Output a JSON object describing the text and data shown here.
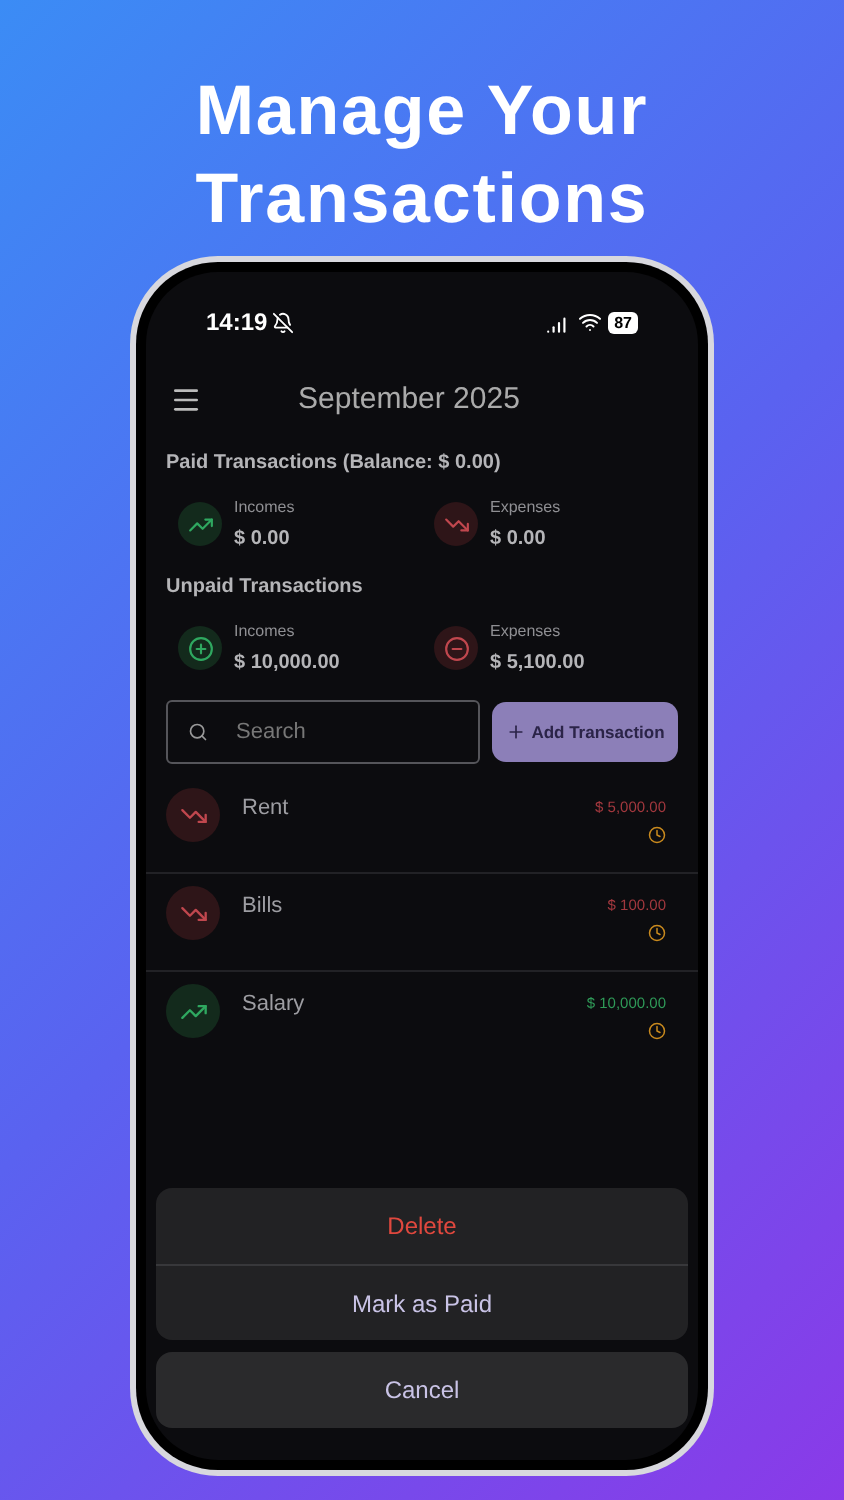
{
  "headline": [
    "Manage Your",
    "Transactions"
  ],
  "status_bar": {
    "time": "14:19",
    "battery": "87"
  },
  "header": {
    "title": "September 2025"
  },
  "sections": [
    {
      "kind": "paid",
      "title": "Paid Transactions (Balance: $ 0.00)",
      "stats": [
        {
          "kind": "income",
          "label": "Incomes",
          "value": "$ 0.00"
        },
        {
          "kind": "expense",
          "label": "Expenses",
          "value": "$ 0.00"
        }
      ]
    },
    {
      "kind": "unpaid",
      "title": "Unpaid Transactions",
      "stats": [
        {
          "kind": "income",
          "label": "Incomes",
          "value": "$ 10,000.00"
        },
        {
          "kind": "expense",
          "label": "Expenses",
          "value": "$ 5,100.00"
        }
      ]
    }
  ],
  "search": {
    "placeholder": "Search"
  },
  "add_button": {
    "label": "Add Transaction"
  },
  "transactions": [
    {
      "kind": "expense",
      "name": "Rent",
      "amount": "$ 5,000.00"
    },
    {
      "kind": "expense",
      "name": "Bills",
      "amount": "$ 100.00"
    },
    {
      "kind": "income",
      "name": "Salary",
      "amount": "$ 10,000.00"
    }
  ],
  "action_sheet": {
    "actions": [
      {
        "kind": "destructive",
        "label": "Delete"
      },
      {
        "kind": "default",
        "label": "Mark as Paid"
      }
    ],
    "cancel": "Cancel"
  }
}
